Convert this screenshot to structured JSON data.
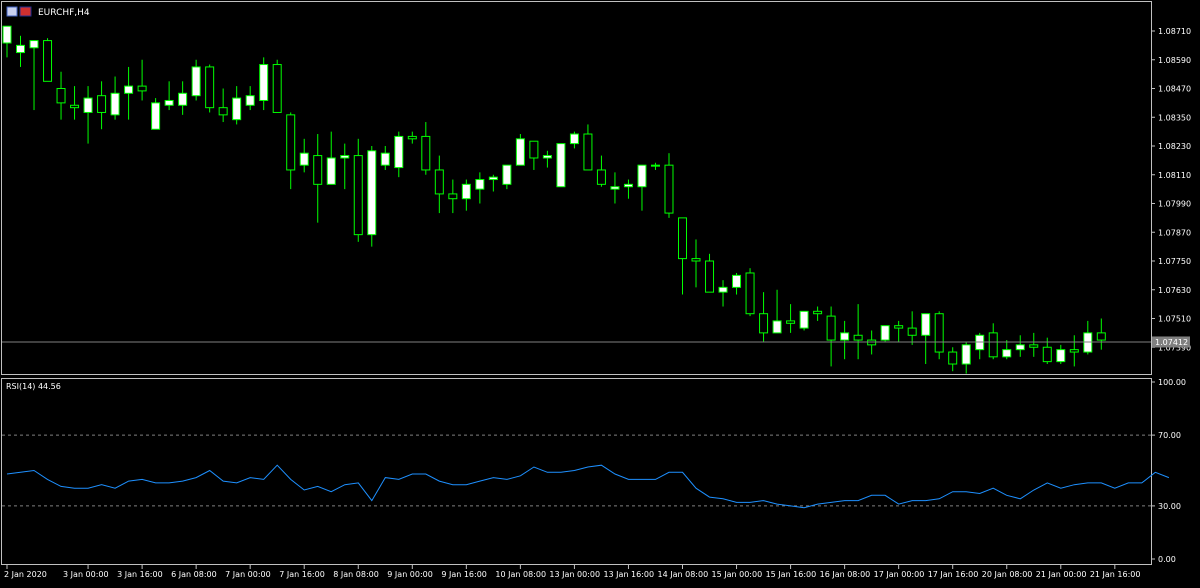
{
  "window": {
    "title": "EURCHF,H4",
    "icon_a": "chart-window-icon",
    "icon_b": "flag-icon"
  },
  "colors": {
    "background": "#000000",
    "frame": "#c0c0c0",
    "bull_body": "#ffffff",
    "bear_body": "#000000",
    "wick": "#00ff00",
    "bid_line": "#808080",
    "rsi_line": "#1e90ff",
    "rsi_levels": "#808080",
    "price_tag_bg": "#808080"
  },
  "chart_data": [
    {
      "type": "candlestick",
      "title": "EURCHF,H4",
      "current_price": 1.07412,
      "current_price_label": "1.07412",
      "y_ticks": [
        "1.08710",
        "1.08590",
        "1.08470",
        "1.08350",
        "1.08230",
        "1.08110",
        "1.07990",
        "1.07870",
        "1.07750",
        "1.07630",
        "1.07510",
        "1.07390"
      ],
      "ylim": [
        1.0733,
        1.0878
      ],
      "x_ticks": [
        {
          "label": "2 Jan 2020",
          "index": 0
        },
        {
          "label": "3 Jan 00:00",
          "index": 6
        },
        {
          "label": "3 Jan 16:00",
          "index": 10
        },
        {
          "label": "6 Jan 08:00",
          "index": 14
        },
        {
          "label": "7 Jan 00:00",
          "index": 18
        },
        {
          "label": "7 Jan 16:00",
          "index": 22
        },
        {
          "label": "8 Jan 08:00",
          "index": 26
        },
        {
          "label": "9 Jan 00:00",
          "index": 30
        },
        {
          "label": "9 Jan 16:00",
          "index": 34
        },
        {
          "label": "10 Jan 08:00",
          "index": 38
        },
        {
          "label": "13 Jan 00:00",
          "index": 42
        },
        {
          "label": "13 Jan 16:00",
          "index": 46
        },
        {
          "label": "14 Jan 08:00",
          "index": 50
        },
        {
          "label": "15 Jan 00:00",
          "index": 54
        },
        {
          "label": "15 Jan 16:00",
          "index": 58
        },
        {
          "label": "16 Jan 08:00",
          "index": 62
        },
        {
          "label": "17 Jan 00:00",
          "index": 66
        },
        {
          "label": "17 Jan 16:00",
          "index": 70
        },
        {
          "label": "20 Jan 08:00",
          "index": 74
        },
        {
          "label": "21 Jan 00:00",
          "index": 78
        },
        {
          "label": "21 Jan 16:00",
          "index": 82
        }
      ],
      "candles": [
        {
          "o": 1.0866,
          "h": 1.0873,
          "l": 1.086,
          "c": 1.0873
        },
        {
          "o": 1.0862,
          "h": 1.0869,
          "l": 1.0856,
          "c": 1.0865
        },
        {
          "o": 1.0864,
          "h": 1.0867,
          "l": 1.0838,
          "c": 1.0867
        },
        {
          "o": 1.0867,
          "h": 1.0868,
          "l": 1.0856,
          "c": 1.085
        },
        {
          "o": 1.0847,
          "h": 1.0854,
          "l": 1.0834,
          "c": 1.0841
        },
        {
          "o": 1.084,
          "h": 1.0848,
          "l": 1.0834,
          "c": 1.0839
        },
        {
          "o": 1.0837,
          "h": 1.0848,
          "l": 1.0824,
          "c": 1.0843
        },
        {
          "o": 1.0844,
          "h": 1.085,
          "l": 1.083,
          "c": 1.0837
        },
        {
          "o": 1.0836,
          "h": 1.0852,
          "l": 1.0834,
          "c": 1.0845
        },
        {
          "o": 1.0845,
          "h": 1.0856,
          "l": 1.0834,
          "c": 1.0848
        },
        {
          "o": 1.0848,
          "h": 1.0859,
          "l": 1.0842,
          "c": 1.0846
        },
        {
          "o": 1.083,
          "h": 1.0843,
          "l": 1.083,
          "c": 1.0841
        },
        {
          "o": 1.084,
          "h": 1.085,
          "l": 1.0838,
          "c": 1.0842
        },
        {
          "o": 1.084,
          "h": 1.085,
          "l": 1.0836,
          "c": 1.0845
        },
        {
          "o": 1.0844,
          "h": 1.0859,
          "l": 1.0842,
          "c": 1.0856
        },
        {
          "o": 1.0856,
          "h": 1.0857,
          "l": 1.0837,
          "c": 1.0839
        },
        {
          "o": 1.0839,
          "h": 1.0847,
          "l": 1.0833,
          "c": 1.0836
        },
        {
          "o": 1.0834,
          "h": 1.0848,
          "l": 1.0832,
          "c": 1.0843
        },
        {
          "o": 1.084,
          "h": 1.0848,
          "l": 1.0838,
          "c": 1.0844
        },
        {
          "o": 1.0842,
          "h": 1.086,
          "l": 1.0838,
          "c": 1.0857
        },
        {
          "o": 1.0857,
          "h": 1.0859,
          "l": 1.0837,
          "c": 1.0837
        },
        {
          "o": 1.0836,
          "h": 1.0837,
          "l": 1.0805,
          "c": 1.0813
        },
        {
          "o": 1.0815,
          "h": 1.0826,
          "l": 1.0812,
          "c": 1.082
        },
        {
          "o": 1.0819,
          "h": 1.0828,
          "l": 1.0791,
          "c": 1.0807
        },
        {
          "o": 1.0807,
          "h": 1.0829,
          "l": 1.0807,
          "c": 1.0818
        },
        {
          "o": 1.0818,
          "h": 1.0824,
          "l": 1.0805,
          "c": 1.0819
        },
        {
          "o": 1.0819,
          "h": 1.0826,
          "l": 1.0783,
          "c": 1.0786
        },
        {
          "o": 1.0786,
          "h": 1.0823,
          "l": 1.0781,
          "c": 1.0821
        },
        {
          "o": 1.0815,
          "h": 1.0823,
          "l": 1.0813,
          "c": 1.082
        },
        {
          "o": 1.0814,
          "h": 1.0829,
          "l": 1.081,
          "c": 1.0827
        },
        {
          "o": 1.0827,
          "h": 1.0829,
          "l": 1.0824,
          "c": 1.0826
        },
        {
          "o": 1.0827,
          "h": 1.0833,
          "l": 1.0811,
          "c": 1.0813
        },
        {
          "o": 1.0813,
          "h": 1.0819,
          "l": 1.0795,
          "c": 1.0803
        },
        {
          "o": 1.0803,
          "h": 1.0809,
          "l": 1.0795,
          "c": 1.0801
        },
        {
          "o": 1.0801,
          "h": 1.0809,
          "l": 1.0796,
          "c": 1.0807
        },
        {
          "o": 1.0805,
          "h": 1.0812,
          "l": 1.0799,
          "c": 1.0809
        },
        {
          "o": 1.0809,
          "h": 1.0811,
          "l": 1.0804,
          "c": 1.081
        },
        {
          "o": 1.0807,
          "h": 1.0812,
          "l": 1.0805,
          "c": 1.0815
        },
        {
          "o": 1.0815,
          "h": 1.0828,
          "l": 1.0815,
          "c": 1.0826
        },
        {
          "o": 1.0825,
          "h": 1.0825,
          "l": 1.0813,
          "c": 1.0818
        },
        {
          "o": 1.0818,
          "h": 1.0821,
          "l": 1.0814,
          "c": 1.0819
        },
        {
          "o": 1.0806,
          "h": 1.0824,
          "l": 1.0806,
          "c": 1.0824
        },
        {
          "o": 1.0824,
          "h": 1.0829,
          "l": 1.0822,
          "c": 1.0828
        },
        {
          "o": 1.0828,
          "h": 1.0832,
          "l": 1.0814,
          "c": 1.0813
        },
        {
          "o": 1.0813,
          "h": 1.0819,
          "l": 1.0806,
          "c": 1.0807
        },
        {
          "o": 1.0805,
          "h": 1.0812,
          "l": 1.0799,
          "c": 1.0806
        },
        {
          "o": 1.0806,
          "h": 1.0809,
          "l": 1.0801,
          "c": 1.0807
        },
        {
          "o": 1.0806,
          "h": 1.0815,
          "l": 1.0796,
          "c": 1.0815
        },
        {
          "o": 1.0815,
          "h": 1.0816,
          "l": 1.0813,
          "c": 1.0815
        },
        {
          "o": 1.0815,
          "h": 1.082,
          "l": 1.0793,
          "c": 1.0795
        },
        {
          "o": 1.0793,
          "h": 1.0793,
          "l": 1.0761,
          "c": 1.0776
        },
        {
          "o": 1.0776,
          "h": 1.0784,
          "l": 1.0764,
          "c": 1.0775
        },
        {
          "o": 1.0775,
          "h": 1.0778,
          "l": 1.0763,
          "c": 1.0762
        },
        {
          "o": 1.0762,
          "h": 1.0767,
          "l": 1.0756,
          "c": 1.0764
        },
        {
          "o": 1.0764,
          "h": 1.077,
          "l": 1.0761,
          "c": 1.0769
        },
        {
          "o": 1.077,
          "h": 1.0772,
          "l": 1.0752,
          "c": 1.0753
        },
        {
          "o": 1.0753,
          "h": 1.0762,
          "l": 1.0741,
          "c": 1.0745
        },
        {
          "o": 1.0745,
          "h": 1.0763,
          "l": 1.0745,
          "c": 1.075
        },
        {
          "o": 1.075,
          "h": 1.0757,
          "l": 1.0745,
          "c": 1.0749
        },
        {
          "o": 1.0747,
          "h": 1.0754,
          "l": 1.0746,
          "c": 1.0754
        },
        {
          "o": 1.0754,
          "h": 1.0756,
          "l": 1.075,
          "c": 1.0753
        },
        {
          "o": 1.0752,
          "h": 1.0756,
          "l": 1.0731,
          "c": 1.0742
        },
        {
          "o": 1.0742,
          "h": 1.075,
          "l": 1.0734,
          "c": 1.0745
        },
        {
          "o": 1.0744,
          "h": 1.0757,
          "l": 1.0734,
          "c": 1.0742
        },
        {
          "o": 1.0742,
          "h": 1.0746,
          "l": 1.0736,
          "c": 1.074
        },
        {
          "o": 1.0742,
          "h": 1.0748,
          "l": 1.0741,
          "c": 1.0748
        },
        {
          "o": 1.0748,
          "h": 1.075,
          "l": 1.0741,
          "c": 1.0747
        },
        {
          "o": 1.0747,
          "h": 1.0754,
          "l": 1.074,
          "c": 1.0744
        },
        {
          "o": 1.0744,
          "h": 1.0751,
          "l": 1.0732,
          "c": 1.0753
        },
        {
          "o": 1.0753,
          "h": 1.0754,
          "l": 1.0734,
          "c": 1.0737
        },
        {
          "o": 1.0737,
          "h": 1.0739,
          "l": 1.0729,
          "c": 1.0732
        },
        {
          "o": 1.0732,
          "h": 1.0741,
          "l": 1.0728,
          "c": 1.074
        },
        {
          "o": 1.0738,
          "h": 1.0745,
          "l": 1.0734,
          "c": 1.0744
        },
        {
          "o": 1.0745,
          "h": 1.0749,
          "l": 1.0734,
          "c": 1.0735
        },
        {
          "o": 1.0735,
          "h": 1.0742,
          "l": 1.0734,
          "c": 1.0738
        },
        {
          "o": 1.0738,
          "h": 1.0744,
          "l": 1.0735,
          "c": 1.074
        },
        {
          "o": 1.074,
          "h": 1.0745,
          "l": 1.0735,
          "c": 1.0739
        },
        {
          "o": 1.0739,
          "h": 1.0743,
          "l": 1.0732,
          "c": 1.0733
        },
        {
          "o": 1.0733,
          "h": 1.074,
          "l": 1.0732,
          "c": 1.0738
        },
        {
          "o": 1.0738,
          "h": 1.0744,
          "l": 1.0731,
          "c": 1.0737
        },
        {
          "o": 1.0737,
          "h": 1.075,
          "l": 1.0736,
          "c": 1.0745
        },
        {
          "o": 1.0745,
          "h": 1.0751,
          "l": 1.0738,
          "c": 1.0742
        }
      ]
    },
    {
      "type": "line",
      "title": "RSI(14) 44.56",
      "ylim": [
        0,
        100
      ],
      "y_ticks": [
        "100.00",
        "70.00",
        "30.00",
        "0.00"
      ],
      "levels": [
        70,
        30
      ],
      "series": [
        {
          "values": [
            48,
            49,
            50,
            45,
            41,
            40,
            40,
            42,
            40,
            44,
            45,
            43,
            43,
            44,
            46,
            50,
            44,
            43,
            46,
            45,
            53,
            45,
            39,
            41,
            38,
            42,
            43,
            33,
            46,
            45,
            48,
            48,
            44,
            42,
            42,
            44,
            46,
            45,
            47,
            52,
            49,
            49,
            50,
            52,
            53,
            48,
            45,
            45,
            45,
            49,
            49,
            40,
            35,
            34,
            32,
            32,
            33,
            31,
            30,
            29,
            31,
            32,
            33,
            33,
            36,
            36,
            31,
            33,
            33,
            34,
            38,
            38,
            37,
            40,
            36,
            34,
            39,
            43,
            40,
            42,
            43,
            43,
            40,
            43,
            43,
            49,
            46
          ]
        }
      ]
    }
  ]
}
